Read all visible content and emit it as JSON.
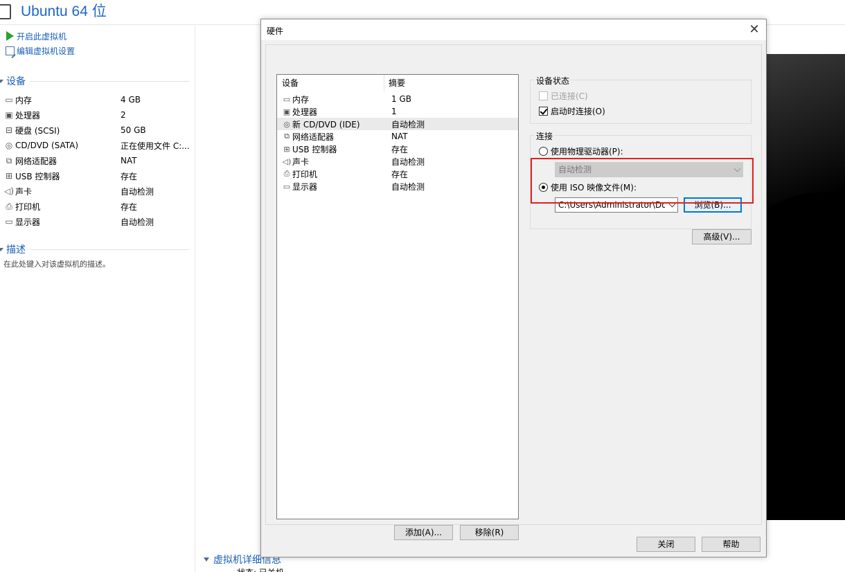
{
  "vm": {
    "name": "Ubuntu 64 位",
    "actions": [
      {
        "label": "开启此虚拟机",
        "icon": "play-icon"
      },
      {
        "label": "编辑虚拟机设置",
        "icon": "edit-settings-icon"
      }
    ],
    "devices_title": "设备",
    "devices": [
      {
        "name": "内存",
        "value": "4 GB",
        "icon": "memory-icon"
      },
      {
        "name": "处理器",
        "value": "2",
        "icon": "processor-icon"
      },
      {
        "name": "硬盘 (SCSI)",
        "value": "50 GB",
        "icon": "hard-disk-icon"
      },
      {
        "name": "CD/DVD (SATA)",
        "value": "正在使用文件 C:...",
        "icon": "cd-dvd-icon"
      },
      {
        "name": "网络适配器",
        "value": "NAT",
        "icon": "network-adapter-icon"
      },
      {
        "name": "USB 控制器",
        "value": "存在",
        "icon": "usb-icon"
      },
      {
        "name": "声卡",
        "value": "自动检测",
        "icon": "sound-card-icon"
      },
      {
        "name": "打印机",
        "value": "存在",
        "icon": "printer-icon"
      },
      {
        "name": "显示器",
        "value": "自动检测",
        "icon": "display-icon"
      }
    ],
    "description_title": "描述",
    "description_placeholder": "在此处键入对该虚拟机的描述。",
    "details_title": "虚拟机详细信息",
    "details_cut": "状态: 已关机"
  },
  "dialog": {
    "title": "硬件",
    "list_headers": {
      "device": "设备",
      "summary": "摘要"
    },
    "devices": [
      {
        "name": "内存",
        "summary": "1 GB",
        "icon": "memory-icon",
        "selected": false
      },
      {
        "name": "处理器",
        "summary": "1",
        "icon": "processor-icon",
        "selected": false
      },
      {
        "name": "新 CD/DVD (IDE)",
        "summary": "自动检测",
        "icon": "cd-dvd-icon",
        "selected": true
      },
      {
        "name": "网络适配器",
        "summary": "NAT",
        "icon": "network-adapter-icon",
        "selected": false
      },
      {
        "name": "USB 控制器",
        "summary": "存在",
        "icon": "usb-icon",
        "selected": false
      },
      {
        "name": "声卡",
        "summary": "自动检测",
        "icon": "sound-card-icon",
        "selected": false
      },
      {
        "name": "打印机",
        "summary": "存在",
        "icon": "printer-icon",
        "selected": false
      },
      {
        "name": "显示器",
        "summary": "自动检测",
        "icon": "display-icon",
        "selected": false
      }
    ],
    "add_button": "添加(A)...",
    "remove_button": "移除(R)",
    "device_status": {
      "title": "设备状态",
      "connected": {
        "label": "已连接(C)",
        "checked": false,
        "enabled": false
      },
      "connect_at_power_on": {
        "label": "启动时连接(O)",
        "checked": true,
        "enabled": true
      }
    },
    "connection": {
      "title": "连接",
      "physical_drive": {
        "label": "使用物理驱动器(P):",
        "selected": false,
        "value": "自动检测"
      },
      "iso_image": {
        "label": "使用 ISO 映像文件(M):",
        "selected": true,
        "path": "C:\\Users\\Administrator\\Dow"
      },
      "browse_button": "浏览(B)...",
      "advanced_button": "高级(V)..."
    },
    "close_button": "关闭",
    "help_button": "帮助",
    "highlight_color": "#e02020"
  }
}
